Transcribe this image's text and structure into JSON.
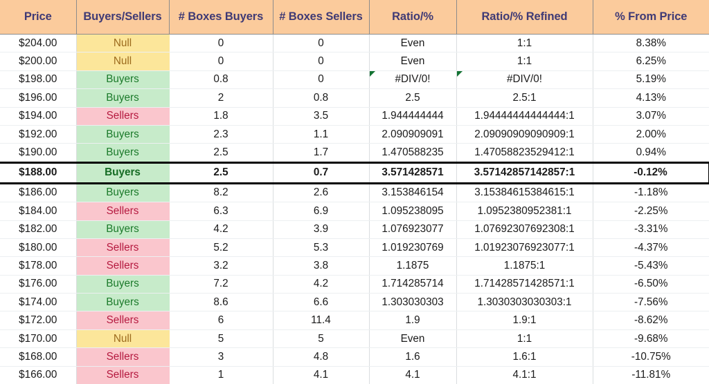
{
  "table": {
    "columns": [
      {
        "key": "price",
        "label": "Price"
      },
      {
        "key": "side",
        "label": "Buyers/Sellers"
      },
      {
        "key": "boxes_buy",
        "label": "# Boxes Buyers"
      },
      {
        "key": "boxes_sell",
        "label": "# Boxes Sellers"
      },
      {
        "key": "ratio",
        "label": "Ratio/%"
      },
      {
        "key": "ratio_ref",
        "label": "Ratio/% Refined"
      },
      {
        "key": "pct",
        "label": "% From Price"
      }
    ],
    "colors": {
      "header_bg": "#FBCB9C",
      "header_text": "#3F3A75",
      "null_bg": "#FCE69A",
      "null_text": "#9C6B1E",
      "buyers_bg": "#C7EBCA",
      "buyers_text": "#1B7A2A",
      "sellers_bg": "#FAC6CD",
      "sellers_text": "#B5193F",
      "highlight_border": "#000000",
      "error_flag": "#137333"
    },
    "rows": [
      {
        "price": "$204.00",
        "side": "Null",
        "side_kind": "null",
        "boxes_buy": "0",
        "boxes_sell": "0",
        "ratio": "Even",
        "ratio_ref": "1:1",
        "pct": "8.38%",
        "highlight": false,
        "flag": false
      },
      {
        "price": "$200.00",
        "side": "Null",
        "side_kind": "null",
        "boxes_buy": "0",
        "boxes_sell": "0",
        "ratio": "Even",
        "ratio_ref": "1:1",
        "pct": "6.25%",
        "highlight": false,
        "flag": false
      },
      {
        "price": "$198.00",
        "side": "Buyers",
        "side_kind": "buyers",
        "boxes_buy": "0.8",
        "boxes_sell": "0",
        "ratio": "#DIV/0!",
        "ratio_ref": "#DIV/0!",
        "pct": "5.19%",
        "highlight": false,
        "flag": true
      },
      {
        "price": "$196.00",
        "side": "Buyers",
        "side_kind": "buyers",
        "boxes_buy": "2",
        "boxes_sell": "0.8",
        "ratio": "2.5",
        "ratio_ref": "2.5:1",
        "pct": "4.13%",
        "highlight": false,
        "flag": false
      },
      {
        "price": "$194.00",
        "side": "Sellers",
        "side_kind": "sellers",
        "boxes_buy": "1.8",
        "boxes_sell": "3.5",
        "ratio": "1.944444444",
        "ratio_ref": "1.94444444444444:1",
        "pct": "3.07%",
        "highlight": false,
        "flag": false
      },
      {
        "price": "$192.00",
        "side": "Buyers",
        "side_kind": "buyers",
        "boxes_buy": "2.3",
        "boxes_sell": "1.1",
        "ratio": "2.090909091",
        "ratio_ref": "2.09090909090909:1",
        "pct": "2.00%",
        "highlight": false,
        "flag": false
      },
      {
        "price": "$190.00",
        "side": "Buyers",
        "side_kind": "buyers",
        "boxes_buy": "2.5",
        "boxes_sell": "1.7",
        "ratio": "1.470588235",
        "ratio_ref": "1.47058823529412:1",
        "pct": "0.94%",
        "highlight": false,
        "flag": false
      },
      {
        "price": "$188.00",
        "side": "Buyers",
        "side_kind": "buyers",
        "boxes_buy": "2.5",
        "boxes_sell": "0.7",
        "ratio": "3.571428571",
        "ratio_ref": "3.57142857142857:1",
        "pct": "-0.12%",
        "highlight": true,
        "flag": false
      },
      {
        "price": "$186.00",
        "side": "Buyers",
        "side_kind": "buyers",
        "boxes_buy": "8.2",
        "boxes_sell": "2.6",
        "ratio": "3.153846154",
        "ratio_ref": "3.15384615384615:1",
        "pct": "-1.18%",
        "highlight": false,
        "flag": false
      },
      {
        "price": "$184.00",
        "side": "Sellers",
        "side_kind": "sellers",
        "boxes_buy": "6.3",
        "boxes_sell": "6.9",
        "ratio": "1.095238095",
        "ratio_ref": "1.0952380952381:1",
        "pct": "-2.25%",
        "highlight": false,
        "flag": false
      },
      {
        "price": "$182.00",
        "side": "Buyers",
        "side_kind": "buyers",
        "boxes_buy": "4.2",
        "boxes_sell": "3.9",
        "ratio": "1.076923077",
        "ratio_ref": "1.07692307692308:1",
        "pct": "-3.31%",
        "highlight": false,
        "flag": false
      },
      {
        "price": "$180.00",
        "side": "Sellers",
        "side_kind": "sellers",
        "boxes_buy": "5.2",
        "boxes_sell": "5.3",
        "ratio": "1.019230769",
        "ratio_ref": "1.01923076923077:1",
        "pct": "-4.37%",
        "highlight": false,
        "flag": false
      },
      {
        "price": "$178.00",
        "side": "Sellers",
        "side_kind": "sellers",
        "boxes_buy": "3.2",
        "boxes_sell": "3.8",
        "ratio": "1.1875",
        "ratio_ref": "1.1875:1",
        "pct": "-5.43%",
        "highlight": false,
        "flag": false
      },
      {
        "price": "$176.00",
        "side": "Buyers",
        "side_kind": "buyers",
        "boxes_buy": "7.2",
        "boxes_sell": "4.2",
        "ratio": "1.714285714",
        "ratio_ref": "1.71428571428571:1",
        "pct": "-6.50%",
        "highlight": false,
        "flag": false
      },
      {
        "price": "$174.00",
        "side": "Buyers",
        "side_kind": "buyers",
        "boxes_buy": "8.6",
        "boxes_sell": "6.6",
        "ratio": "1.303030303",
        "ratio_ref": "1.3030303030303:1",
        "pct": "-7.56%",
        "highlight": false,
        "flag": false
      },
      {
        "price": "$172.00",
        "side": "Sellers",
        "side_kind": "sellers",
        "boxes_buy": "6",
        "boxes_sell": "11.4",
        "ratio": "1.9",
        "ratio_ref": "1.9:1",
        "pct": "-8.62%",
        "highlight": false,
        "flag": false
      },
      {
        "price": "$170.00",
        "side": "Null",
        "side_kind": "null",
        "boxes_buy": "5",
        "boxes_sell": "5",
        "ratio": "Even",
        "ratio_ref": "1:1",
        "pct": "-9.68%",
        "highlight": false,
        "flag": false
      },
      {
        "price": "$168.00",
        "side": "Sellers",
        "side_kind": "sellers",
        "boxes_buy": "3",
        "boxes_sell": "4.8",
        "ratio": "1.6",
        "ratio_ref": "1.6:1",
        "pct": "-10.75%",
        "highlight": false,
        "flag": false
      },
      {
        "price": "$166.00",
        "side": "Sellers",
        "side_kind": "sellers",
        "boxes_buy": "1",
        "boxes_sell": "4.1",
        "ratio": "4.1",
        "ratio_ref": "4.1:1",
        "pct": "-11.81%",
        "highlight": false,
        "flag": false
      }
    ]
  }
}
